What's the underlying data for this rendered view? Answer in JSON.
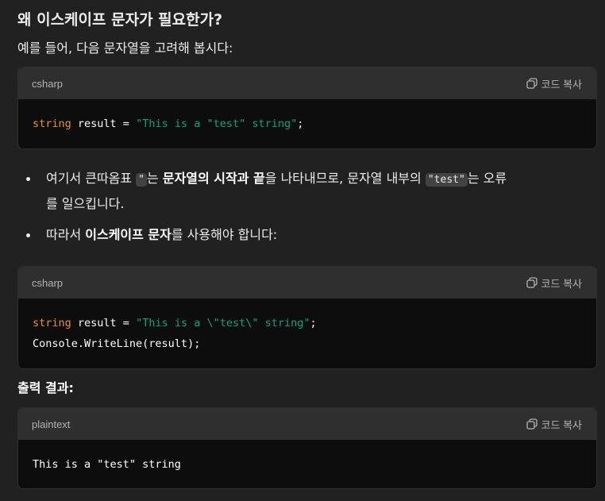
{
  "heading": "왜 이스케이프 문자가 필요한가?",
  "intro": "예를 들어, 다음 문자열을 고려해 봅시다:",
  "copy_label": "코드 복사",
  "code_blocks": [
    {
      "lang": "csharp",
      "lines": [
        {
          "t1": "string",
          "t2": " result = ",
          "t3": "\"This is a \"test\" string\"",
          "t4": ";"
        }
      ]
    },
    {
      "lang": "csharp",
      "lines": [
        {
          "t1": "string",
          "t2": " result = ",
          "t3": "\"This is a \\\"test\\\" string\"",
          "t4": ";"
        },
        {
          "plain": "Console.WriteLine(result);"
        }
      ]
    },
    {
      "lang": "plaintext",
      "lines": [
        {
          "plain": "This is a \"test\" string"
        }
      ]
    }
  ],
  "bullet1": {
    "a": "여기서 큰따옴표 ",
    "code1": "\"",
    "b": "는 ",
    "bold": "문자열의 시작과 끝",
    "c": "을 나타내므로, 문자열 내부의 ",
    "code2": "\"test\"",
    "d": "는 오류",
    "e": "를 일으킵니다."
  },
  "bullet2": {
    "a": "따라서 ",
    "bold": "이스케이프 문자",
    "b": "를 사용해야 합니다:"
  },
  "output_label": "출력 결과:"
}
